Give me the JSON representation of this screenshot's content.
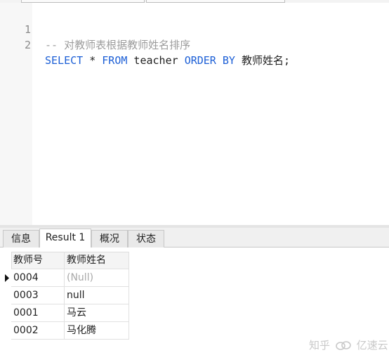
{
  "editor": {
    "lines": [
      {
        "number": "1",
        "comment": "-- 对教师表根据教师姓名排序"
      },
      {
        "number": "2",
        "kw1": "SELECT",
        "star": " * ",
        "kw2": "FROM",
        "table": " teacher ",
        "kw3": "ORDER BY",
        "rest": " 教师姓名;"
      }
    ]
  },
  "tabs": [
    "信息",
    "Result 1",
    "概况",
    "状态"
  ],
  "active_tab": "Result 1",
  "grid": {
    "columns": [
      "教师号",
      "教师姓名"
    ],
    "rows": [
      [
        "0004",
        "(Null)"
      ],
      [
        "0003",
        "null"
      ],
      [
        "0001",
        "马云"
      ],
      [
        "0002",
        "马化腾"
      ]
    ]
  },
  "watermark": {
    "text1": "知乎",
    "text2": "亿速云"
  }
}
